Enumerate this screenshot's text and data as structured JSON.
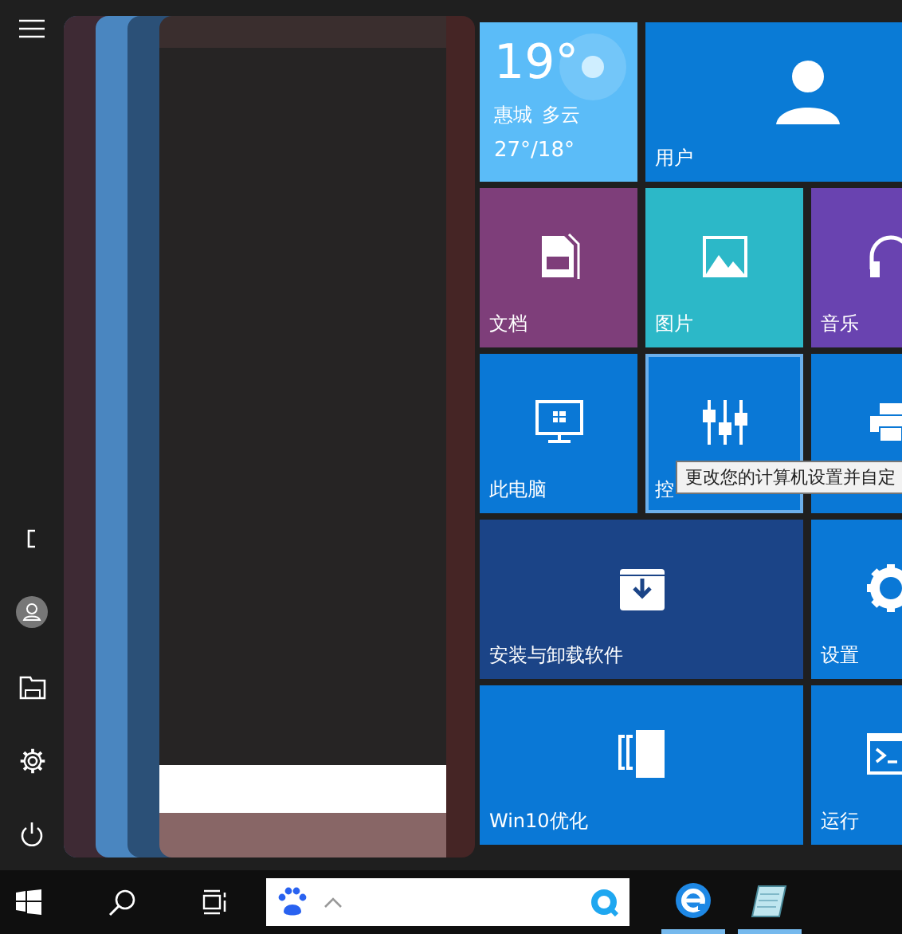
{
  "weather": {
    "temperature": "19°",
    "city": "惠城",
    "condition": "多云",
    "range": "27°/18°",
    "color": "#5bbcf8"
  },
  "tiles": [
    {
      "kind": "user",
      "label": "用户",
      "wide": true,
      "selected": false,
      "color": "#0a7bd6"
    },
    {
      "kind": "documents",
      "label": "文档",
      "wide": false,
      "selected": false,
      "color": "#7e3e7a"
    },
    {
      "kind": "pictures",
      "label": "图片",
      "wide": false,
      "selected": false,
      "color": "#2cb8c8"
    },
    {
      "kind": "music",
      "label": "音乐",
      "wide": false,
      "selected": false,
      "color": "#6943b0"
    },
    {
      "kind": "computer",
      "label": "此电脑",
      "wide": false,
      "selected": false,
      "color": "#0a78d6"
    },
    {
      "kind": "sliders",
      "label": "控",
      "wide": false,
      "selected": true,
      "color": "#0a78d6"
    },
    {
      "kind": "printer",
      "wide": false,
      "selected": false,
      "color": "#0a78d6"
    },
    {
      "kind": "install",
      "label": "安装与卸载软件",
      "wide": true,
      "selected": false,
      "color": "#1b4487"
    },
    {
      "kind": "gear",
      "label": "设置",
      "wide": false,
      "selected": false,
      "color": "#0a78d6"
    },
    {
      "kind": "win10",
      "label": "Win10优化",
      "wide": true,
      "selected": false,
      "color": "#0a78d6"
    },
    {
      "kind": "run",
      "label": "运行",
      "wide": false,
      "selected": false,
      "color": "#0a78d6"
    }
  ],
  "tooltip": "更改您的计算机设置并自定",
  "taskbar": {
    "apps": [
      {
        "kind": "browser",
        "running": true
      },
      {
        "kind": "notepad",
        "running": true
      }
    ]
  }
}
